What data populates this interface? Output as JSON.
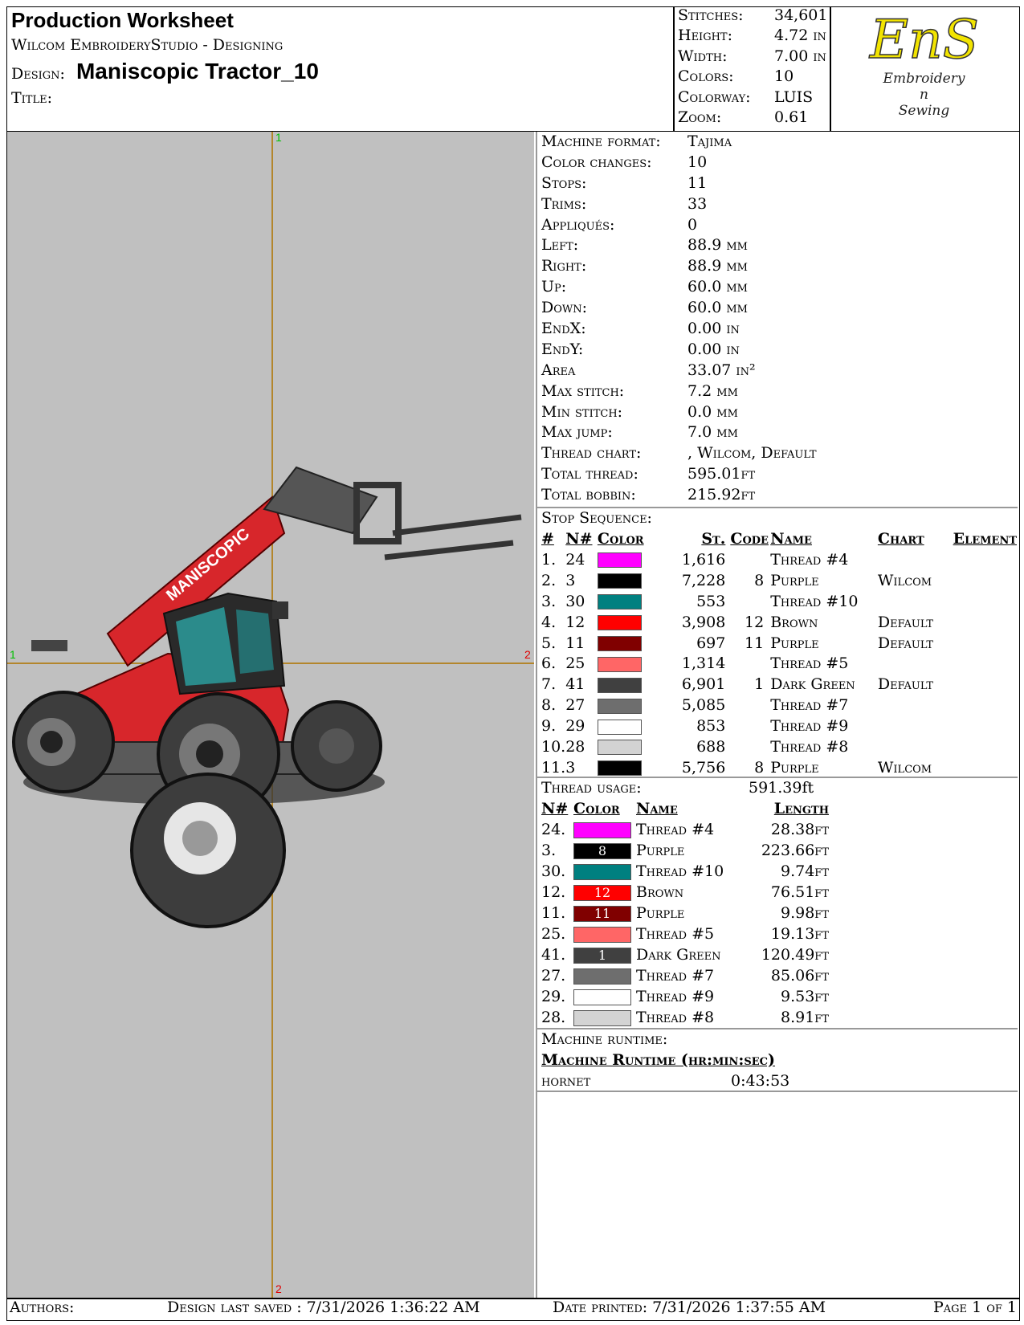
{
  "header": {
    "title": "Production Worksheet",
    "software": "Wilcom EmbroideryStudio - Designing",
    "design_label": "Design:",
    "design_name": "Maniscopic Tractor_10",
    "title_label": "Title:"
  },
  "stats": [
    {
      "k": "Stitches:",
      "v": "34,601"
    },
    {
      "k": "Height:",
      "v": "4.72 in"
    },
    {
      "k": "Width:",
      "v": "7.00 in"
    },
    {
      "k": "Colors:",
      "v": "10"
    },
    {
      "k": "Colorway:",
      "v": "LUIS"
    },
    {
      "k": "Zoom:",
      "v": "0.61"
    }
  ],
  "logo": {
    "mark": "EnS",
    "line1": "Embroidery",
    "line2": "n",
    "line3": "Sewing"
  },
  "canvas": {
    "guide_labels": [
      "1",
      "1",
      "2",
      "2"
    ]
  },
  "info": [
    {
      "k": "Machine format:",
      "v": "Tajima"
    },
    {
      "k": "Color changes:",
      "v": "10"
    },
    {
      "k": "Stops:",
      "v": "11"
    },
    {
      "k": "Trims:",
      "v": "33"
    },
    {
      "k": "Appliqués:",
      "v": "0"
    },
    {
      "k": "Left:",
      "v": "88.9 mm"
    },
    {
      "k": "Right:",
      "v": "88.9 mm"
    },
    {
      "k": "Up:",
      "v": "60.0 mm"
    },
    {
      "k": "Down:",
      "v": "60.0 mm"
    },
    {
      "k": "EndX:",
      "v": "0.00 in"
    },
    {
      "k": "EndY:",
      "v": "0.00 in"
    },
    {
      "k": "Area",
      "v": " 33.07 in²"
    },
    {
      "k": "Max stitch:",
      "v": "7.2 mm"
    },
    {
      "k": "Min stitch:",
      "v": "0.0 mm"
    },
    {
      "k": "Max jump:",
      "v": "7.0 mm"
    },
    {
      "k": "Thread chart:",
      "v": ", Wilcom, Default"
    },
    {
      "k": "Total thread:",
      "v": "595.01ft"
    },
    {
      "k": "Total bobbin:",
      "v": "215.92ft"
    }
  ],
  "stop_sequence": {
    "title": "Stop Sequence:",
    "headers": [
      "#",
      "N#",
      "Color",
      "St.",
      "Code",
      "Name",
      "Chart",
      "Element"
    ],
    "rows": [
      {
        "n": "1.",
        "id": "24",
        "color": "#ff00ff",
        "st": "1,616",
        "code": "",
        "name": "Thread #4",
        "chart": ""
      },
      {
        "n": "2.",
        "id": "3",
        "color": "#000000",
        "st": "7,228",
        "code": "8",
        "name": "Purple",
        "chart": "Wilcom"
      },
      {
        "n": "3.",
        "id": "30",
        "color": "#008080",
        "st": "553",
        "code": "",
        "name": "Thread #10",
        "chart": ""
      },
      {
        "n": "4.",
        "id": "12",
        "color": "#ff0000",
        "st": "3,908",
        "code": "12",
        "name": "Brown",
        "chart": "Default"
      },
      {
        "n": "5.",
        "id": "11",
        "color": "#800000",
        "st": "697",
        "code": "11",
        "name": "Purple",
        "chart": "Default"
      },
      {
        "n": "6.",
        "id": "25",
        "color": "#ff6666",
        "st": "1,314",
        "code": "",
        "name": "Thread #5",
        "chart": ""
      },
      {
        "n": "7.",
        "id": "41",
        "color": "#404040",
        "st": "6,901",
        "code": "1",
        "name": "Dark Green",
        "chart": "Default"
      },
      {
        "n": "8.",
        "id": "27",
        "color": "#6e6e6e",
        "st": "5,085",
        "code": "",
        "name": "Thread #7",
        "chart": ""
      },
      {
        "n": "9.",
        "id": "29",
        "color": "#ffffff",
        "st": "853",
        "code": "",
        "name": "Thread #9",
        "chart": ""
      },
      {
        "n": "10.",
        "id": "28",
        "color": "#d3d3d3",
        "st": "688",
        "code": "",
        "name": "Thread #8",
        "chart": ""
      },
      {
        "n": "11.",
        "id": "3",
        "color": "#000000",
        "st": "5,756",
        "code": "8",
        "name": "Purple",
        "chart": "Wilcom"
      }
    ]
  },
  "thread_usage": {
    "title": "Thread usage:",
    "total": "591.39ft",
    "headers": [
      "N#",
      "Color",
      "Name",
      "Length"
    ],
    "rows": [
      {
        "id": "24.",
        "color": "#ff00ff",
        "code": "",
        "name": "Thread #4",
        "len": "28.38ft"
      },
      {
        "id": "3.",
        "color": "#000000",
        "code": "8",
        "name": "Purple",
        "len": "223.66ft"
      },
      {
        "id": "30.",
        "color": "#008080",
        "code": "",
        "name": "Thread #10",
        "len": "9.74ft"
      },
      {
        "id": "12.",
        "color": "#ff0000",
        "code": "12",
        "name": "Brown",
        "len": "76.51ft"
      },
      {
        "id": "11.",
        "color": "#800000",
        "code": "11",
        "name": "Purple",
        "len": "9.98ft"
      },
      {
        "id": "25.",
        "color": "#ff6666",
        "code": "",
        "name": "Thread #5",
        "len": "19.13ft"
      },
      {
        "id": "41.",
        "color": "#404040",
        "code": "1",
        "name": "Dark Green",
        "len": "120.49ft"
      },
      {
        "id": "27.",
        "color": "#6e6e6e",
        "code": "",
        "name": "Thread #7",
        "len": "85.06ft"
      },
      {
        "id": "29.",
        "color": "#ffffff",
        "code": "",
        "name": "Thread #9",
        "len": "9.53ft"
      },
      {
        "id": "28.",
        "color": "#d3d3d3",
        "code": "",
        "name": "Thread #8",
        "len": "8.91ft"
      }
    ]
  },
  "runtime": {
    "title": "Machine runtime:",
    "header": "Machine Runtime (hr:min:sec)",
    "machine": "hornet",
    "value": "0:43:53"
  },
  "footer": {
    "authors": "Authors:",
    "saved": "Design last saved : 7/31/2026 1:36:22 AM",
    "printed": "Date printed: 7/31/2026 1:37:55 AM",
    "page": "Page 1 of 1"
  }
}
